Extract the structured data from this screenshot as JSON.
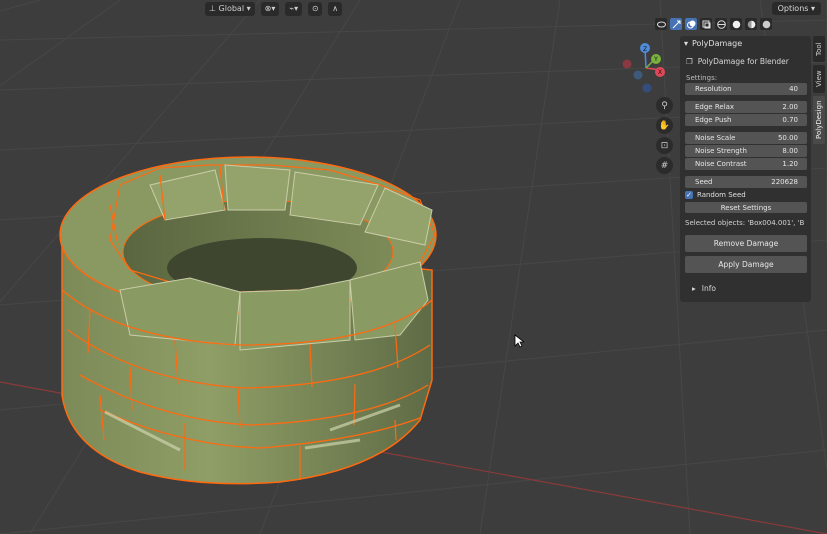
{
  "toolbar": {
    "transform_orientation": "Global",
    "options_label": "Options"
  },
  "icons": {
    "orientation": "orientation-icon",
    "pivot": "pivot-icon",
    "snap": "snap-icon",
    "proportional": "proportional-edit-icon",
    "falloff": "falloff-icon",
    "overlay": "overlay-icon",
    "gizmo": "gizmo-icon",
    "xray": "xray-icon",
    "shading": "shading-icon"
  },
  "gizmo_axes": {
    "x": "X",
    "y": "Y",
    "z": "Z"
  },
  "panel": {
    "title": "PolyDamage",
    "subheader": "PolyDamage for Blender",
    "settings_label": "Settings:",
    "fields": [
      {
        "label": "Resolution",
        "value": "40"
      },
      {
        "label": "Edge Relax",
        "value": "2.00"
      },
      {
        "label": "Edge Push",
        "value": "0.70"
      },
      {
        "label": "Noise Scale",
        "value": "50.00"
      },
      {
        "label": "Noise Strength",
        "value": "8.00"
      },
      {
        "label": "Noise Contrast",
        "value": "1.20"
      },
      {
        "label": "Seed",
        "value": "220628"
      }
    ],
    "random_seed_label": "Random Seed",
    "random_seed_checked": true,
    "reset_label": "Reset Settings",
    "selected_text": "Selected objects:  'Box004.001', 'B",
    "remove_label": "Remove Damage",
    "apply_label": "Apply Damage",
    "info_label": "Info"
  },
  "side_tabs": [
    "Tool",
    "View",
    "PolyDesign"
  ],
  "colors": {
    "viewport_bg": "#3d3d3d",
    "grid": "#474747",
    "x_axis": "#8a3a3a",
    "stone": "#7d8c5a",
    "selection": "#ff6a10",
    "panel_bg": "#303030",
    "field_bg": "#545454",
    "accent_blue": "#4772b3"
  }
}
